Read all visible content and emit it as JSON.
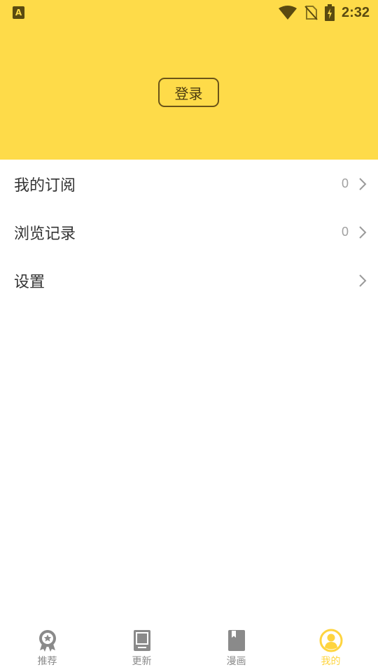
{
  "status_bar": {
    "time": "2:32",
    "left_icon": "app-notification-icon",
    "icons": [
      "wifi-icon",
      "no-sim-icon",
      "battery-charging-icon"
    ]
  },
  "header": {
    "login_label": "登录",
    "background_color": "#fedb49"
  },
  "menu": {
    "items": [
      {
        "label": "我的订阅",
        "count": "0"
      },
      {
        "label": "浏览记录",
        "count": "0"
      },
      {
        "label": "设置",
        "count": ""
      }
    ]
  },
  "tabbar": {
    "active_color": "#fed43f",
    "tabs": [
      {
        "label": "推荐",
        "icon": "award-icon",
        "active": false
      },
      {
        "label": "更新",
        "icon": "tablet-icon",
        "active": false
      },
      {
        "label": "漫画",
        "icon": "book-icon",
        "active": false
      },
      {
        "label": "我的",
        "icon": "user-circle-icon",
        "active": true
      }
    ]
  }
}
